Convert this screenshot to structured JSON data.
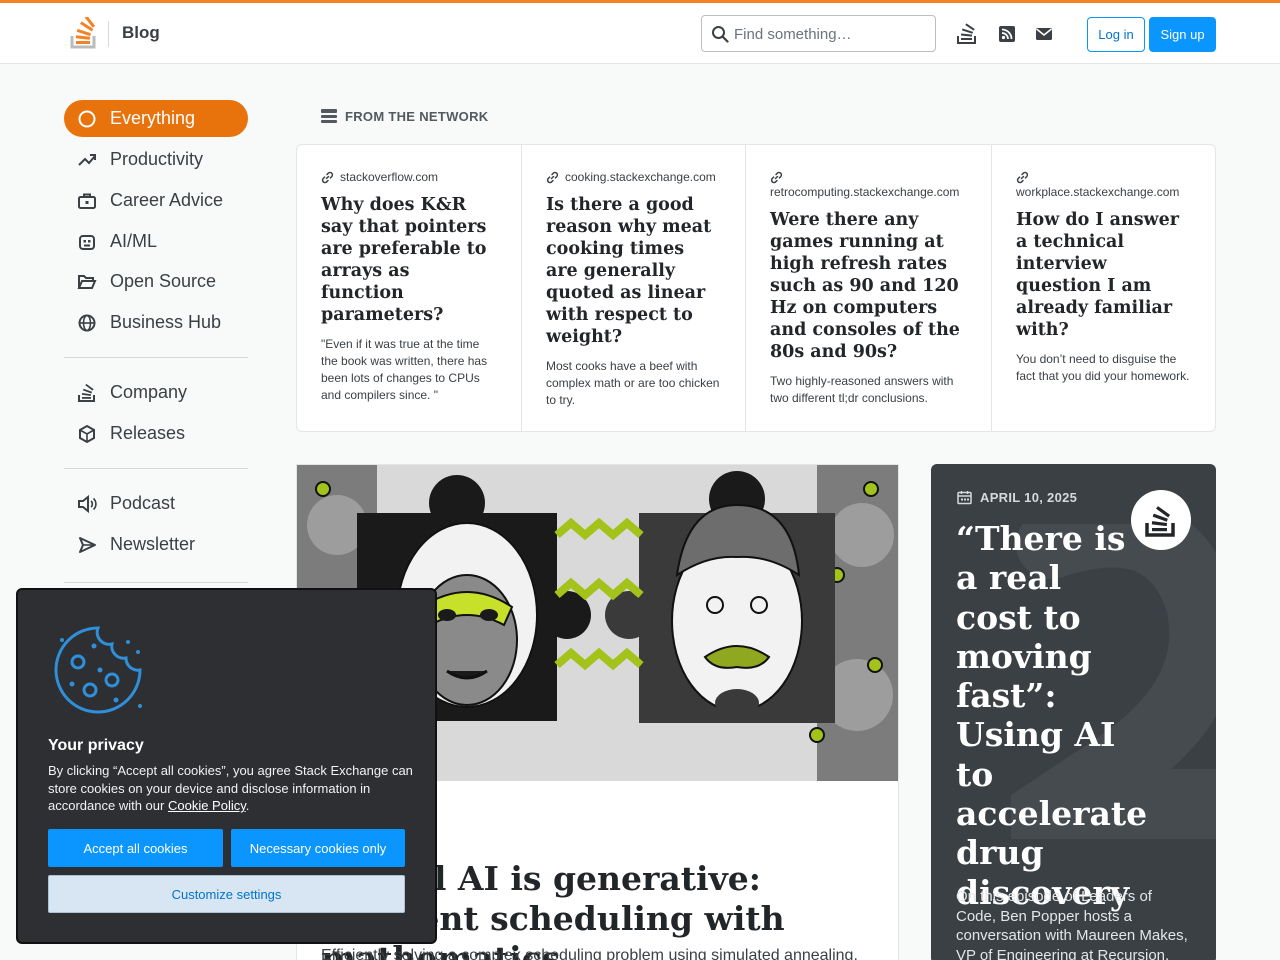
{
  "header": {
    "title": "Blog",
    "search_placeholder": "Find something…",
    "login_label": "Log in",
    "signup_label": "Sign up",
    "accent_color": "#f48225",
    "button_color": "#0a95ff"
  },
  "sidebar": {
    "items": [
      {
        "label": "Everything",
        "icon": "circle-icon",
        "active": true
      },
      {
        "label": "Productivity",
        "icon": "trending-up-icon"
      },
      {
        "label": "Career Advice",
        "icon": "briefcase-icon"
      },
      {
        "label": "AI/ML",
        "icon": "robot-icon"
      },
      {
        "label": "Open Source",
        "icon": "folder-open-icon"
      },
      {
        "label": "Business Hub",
        "icon": "globe-icon"
      },
      {
        "label": "Company",
        "icon": "stack-logo-icon"
      },
      {
        "label": "Releases",
        "icon": "cube-icon"
      },
      {
        "label": "Podcast",
        "icon": "speaker-icon"
      },
      {
        "label": "Newsletter",
        "icon": "send-icon"
      }
    ]
  },
  "network": {
    "heading": "FROM THE NETWORK",
    "cards": [
      {
        "site": "stackoverflow.com",
        "title": "Why does K&R say that pointers are preferable to arrays as function parameters?",
        "desc": "\"Even if it was true at the time the book was written, there has been lots of changes to CPUs and compilers since. \""
      },
      {
        "site": "cooking.stackexchange.com",
        "title": "Is there a good reason why meat cooking times are generally quoted as linear with respect to weight?",
        "desc": "Most cooks have a beef with complex math or are too chicken to try."
      },
      {
        "site": "retrocomputing.stackexchange.com",
        "title": "Were there any games running at high refresh rates such as 90 and 120 Hz on computers and consoles of the 80s and 90s?",
        "desc": "Two highly-reasoned answers with two different tl;dr conclusions."
      },
      {
        "site": "workplace.stackexchange.com",
        "title": "How do I answer a technical interview question I am already familiar with?",
        "desc": "You don’t need to disguise the fact that you did your homework."
      }
    ]
  },
  "feature": {
    "title": "Not all AI is generative: Efficient scheduling with mathematics",
    "desc": "Efficiently solving a complex scheduling problem using simulated annealing."
  },
  "podcast": {
    "date": "APRIL 10, 2025",
    "title": "“There is a real cost to moving fast”: Using AI to accelerate drug discovery",
    "desc": "On this episode of Leaders of Code, Ben Popper hosts a conversation with Maureen Makes, VP of Engineering at Recursion, and Ellen"
  },
  "cookie": {
    "title": "Your privacy",
    "text": "By clicking “Accept all cookies”, you agree Stack Exchange can store cookies on your device and disclose information in accordance with our",
    "link": "Cookie Policy",
    "accept_label": "Accept all cookies",
    "necessary_label": "Necessary cookies only",
    "customize_label": "Customize settings"
  }
}
